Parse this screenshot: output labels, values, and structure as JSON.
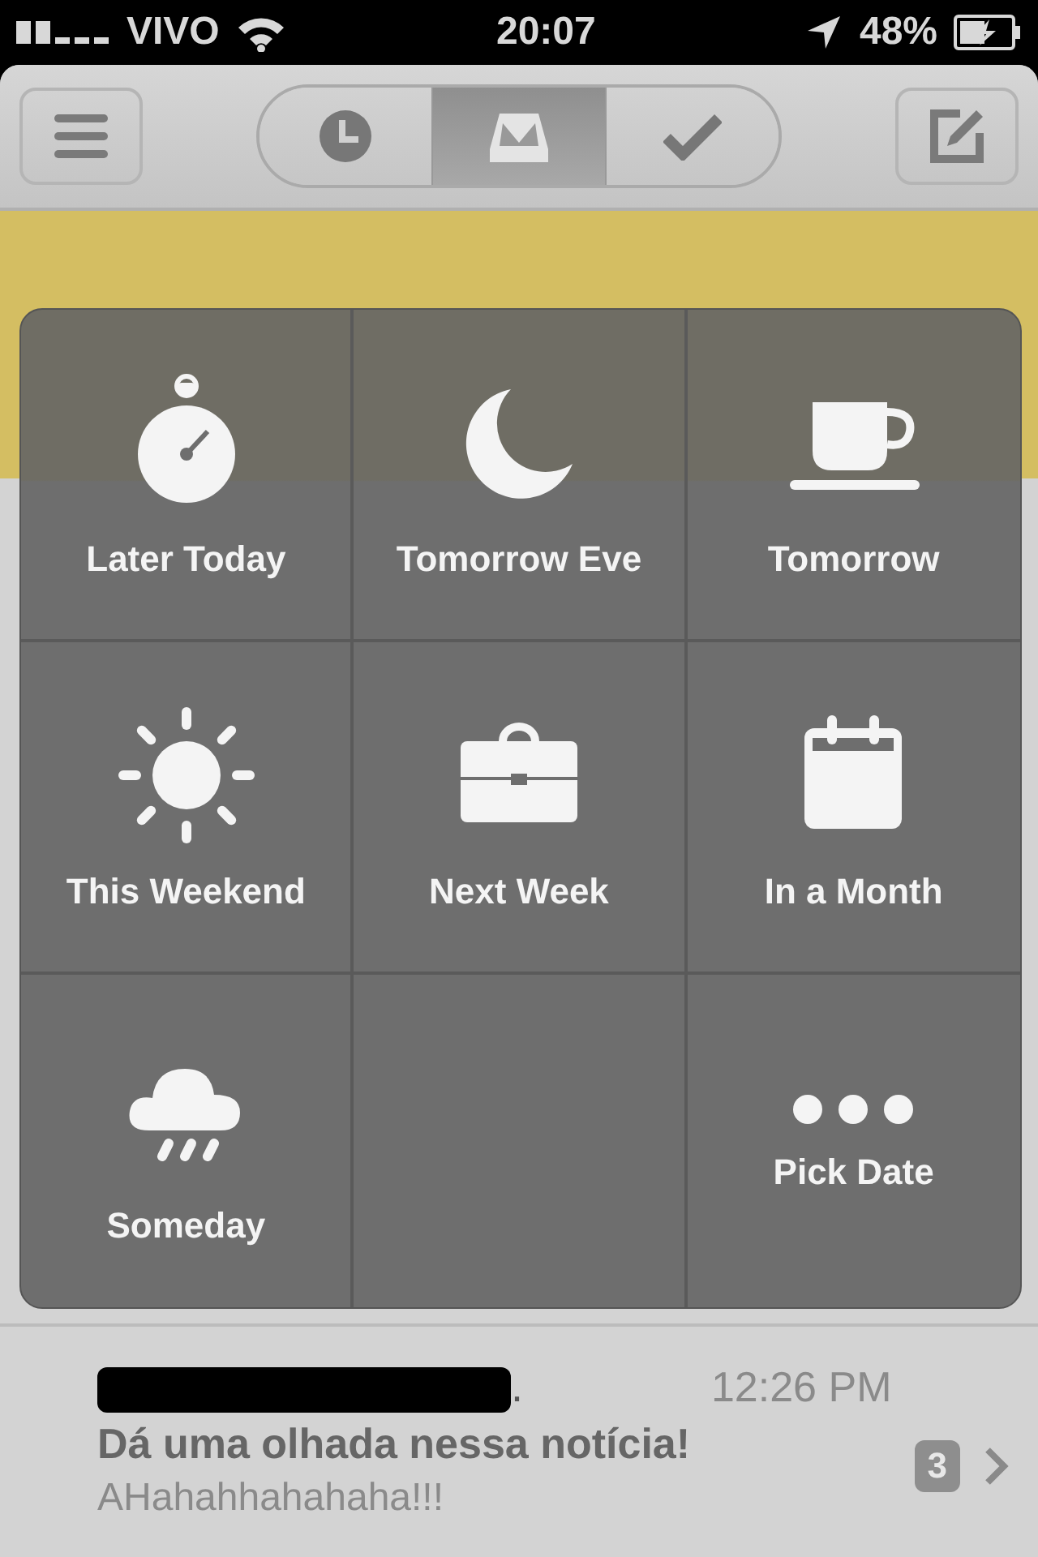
{
  "status_bar": {
    "carrier": "VIVO",
    "time": "20:07",
    "battery": "48%"
  },
  "nav": {
    "segments": [
      {
        "kind": "clock",
        "selected": false
      },
      {
        "kind": "tray",
        "selected": true
      },
      {
        "kind": "check",
        "selected": false
      }
    ]
  },
  "snooze_options": [
    {
      "kind": "timer",
      "label": "Later Today"
    },
    {
      "kind": "moon",
      "label": "Tomorrow Eve"
    },
    {
      "kind": "cup",
      "label": "Tomorrow"
    },
    {
      "kind": "sun",
      "label": "This Weekend"
    },
    {
      "kind": "briefcase",
      "label": "Next Week"
    },
    {
      "kind": "calendar",
      "label": "In a Month"
    },
    {
      "kind": "cloud",
      "label": "Someday"
    },
    {
      "kind": "empty"
    },
    {
      "kind": "dots",
      "label": "Pick Date"
    }
  ],
  "messages": [
    {
      "sender": ".",
      "redacted": true,
      "time": "12:26 PM",
      "subject": "Dá uma olhada nessa notícia!",
      "preview": "AHahahhahahaha!!!",
      "count": "3"
    }
  ]
}
